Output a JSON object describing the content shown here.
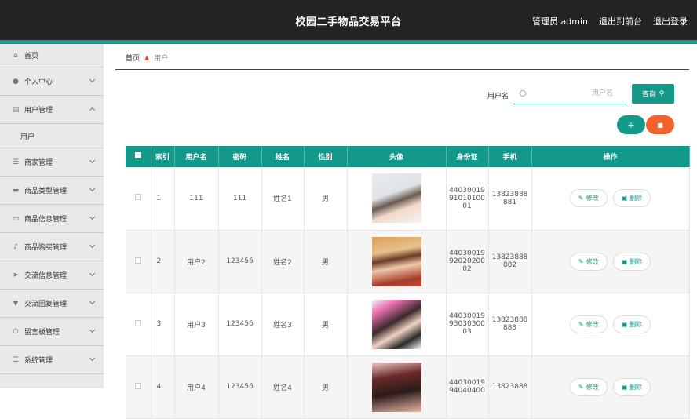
{
  "header": {
    "title": "校园二手物品交易平台",
    "admin": "管理员 admin",
    "back_front": "退出到前台",
    "logout": "退出登录"
  },
  "sidebar": {
    "items": [
      {
        "label": "首页",
        "icon": "home-icon"
      },
      {
        "label": "个人中心",
        "icon": "user-icon"
      },
      {
        "label": "用户管理",
        "icon": "clipboard-icon",
        "expanded": true,
        "sub": [
          "用户"
        ]
      },
      {
        "label": "商家管理",
        "icon": "list-icon"
      },
      {
        "label": "商品类型管理",
        "icon": "message-icon"
      },
      {
        "label": "商品信息管理",
        "icon": "monitor-icon"
      },
      {
        "label": "商品购买管理",
        "icon": "microphone-icon"
      },
      {
        "label": "交流信息管理",
        "icon": "send-icon"
      },
      {
        "label": "交流回复管理",
        "icon": "comment-icon"
      },
      {
        "label": "留言板管理",
        "icon": "power-icon"
      },
      {
        "label": "系统管理",
        "icon": "menu-icon"
      }
    ]
  },
  "breadcrumb": {
    "home": "首页",
    "current": "用户"
  },
  "search": {
    "label": "用户名",
    "placeholder": "用户名",
    "button": "查询"
  },
  "actions": {
    "add": "+",
    "delete_color": "#f2622a",
    "accent": "#13988a"
  },
  "table": {
    "headers": [
      "索引",
      "用户名",
      "密码",
      "姓名",
      "性别",
      "头像",
      "身份证",
      "手机",
      "操作"
    ],
    "edit_label": "修改",
    "delete_label": "删除",
    "rows": [
      {
        "idx": "1",
        "username": "111",
        "password": "111",
        "name": "姓名1",
        "gender": "男",
        "id_card": [
          "44030019",
          "91010100",
          "01"
        ],
        "phone": [
          "13823888",
          "881"
        ]
      },
      {
        "idx": "2",
        "username": "用户2",
        "password": "123456",
        "name": "姓名2",
        "gender": "男",
        "id_card": [
          "44030019",
          "92020200",
          "02"
        ],
        "phone": [
          "13823888",
          "882"
        ]
      },
      {
        "idx": "3",
        "username": "用户3",
        "password": "123456",
        "name": "姓名3",
        "gender": "男",
        "id_card": [
          "44030019",
          "93030300",
          "03"
        ],
        "phone": [
          "13823888",
          "883"
        ]
      },
      {
        "idx": "4",
        "username": "用户4",
        "password": "123456",
        "name": "姓名4",
        "gender": "男",
        "id_card": [
          "44030019",
          "94040400",
          ""
        ],
        "phone": [
          "13823888",
          ""
        ]
      }
    ]
  }
}
